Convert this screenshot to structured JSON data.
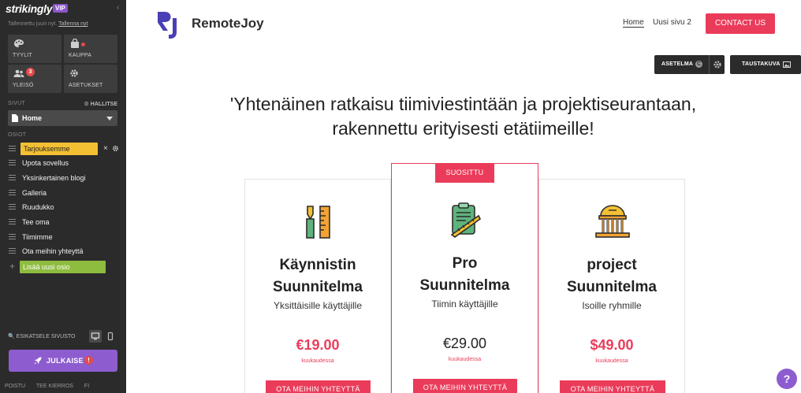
{
  "sidebar": {
    "logo": "strikingly",
    "badge": "VIP",
    "saved_text": "Tallennettu juuri nyt.",
    "saved_link": "Tallenna nyt",
    "tiles": [
      {
        "label": "TYYLIT",
        "icon": "palette-icon"
      },
      {
        "label": "KAUPPA",
        "icon": "shop-bag-icon"
      },
      {
        "label": "YLEISÖ",
        "icon": "audience-icon",
        "count": "3"
      },
      {
        "label": "ASETUKSET",
        "icon": "gear-icon"
      }
    ],
    "pages_label": "SIVUT",
    "manage_label": "HALLITSE",
    "current_page": "Home",
    "sections_label": "OSIOT",
    "sections": [
      "Tarjouksemme",
      "Upota sovellus",
      "Yksinkertainen blogi",
      "Galleria",
      "Ruudukko",
      "Tee oma",
      "Tiimimme",
      "Ota meihin yhteyttä"
    ],
    "add_section": "Lisää uusi osio",
    "preview_label": "ESIKATSELE SIVUSTO",
    "publish_label": "JULKAISE",
    "publish_warning": "!",
    "bottom_links": [
      "POISTU",
      "TEE KIERROS",
      "FI"
    ]
  },
  "site": {
    "brand": "RemoteJoy",
    "logo_letters": "RJ",
    "nav": [
      "Home",
      "Uusi sivu 2"
    ],
    "contact_button": "CONTACT US",
    "edit_buttons": {
      "layout": "ASETELMA",
      "layout_badge": "C",
      "background": "TAUSTAKUVA"
    },
    "headline_line1": "'Yhtenäinen ratkaisu tiimiviestintään ja projektiseurantaan,",
    "headline_line2": "rakennettu erityisesti etätiimeille!",
    "popular_label": "SUOSITTU",
    "plans": [
      {
        "title_line1": "Käynnistin",
        "title_line2": "Suunnitelma",
        "subtitle": "Yksittäisille käyttäjille",
        "price": "€19.00",
        "period": "kuukaudessa",
        "cta": "OTA MEIHIN YHTEYTTÄ",
        "icon": "pen-ruler-icon"
      },
      {
        "title_line1": "Pro",
        "title_line2": "Suunnitelma",
        "subtitle": "Tiimin käyttäjille",
        "price": "€29.00",
        "period": "kuukaudessa",
        "cta": "OTA MEIHIN YHTEYTTÄ",
        "icon": "clipboard-ruler-icon"
      },
      {
        "title_line1": "project",
        "title_line2": "Suunnitelma",
        "subtitle": "Isoille ryhmille",
        "price": "$49.00",
        "period": "kuukaudessa",
        "cta": "OTA MEIHIN YHTEYTTÄ",
        "icon": "building-icon"
      }
    ],
    "help": "?"
  },
  "colors": {
    "accent": "#ea3c5a",
    "sidebar_bg": "#2b2b2b",
    "publish": "#8d5dd0",
    "active_section": "#f3c033",
    "add_section": "#8ebc3f",
    "logo_blue": "#4a3fb5"
  }
}
